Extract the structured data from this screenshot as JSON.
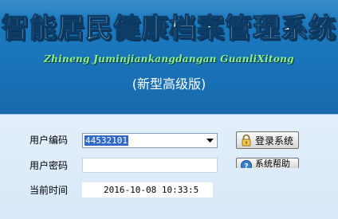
{
  "header": {
    "title": "智能居民健康档案管理系统",
    "subtitle_en": "Zhineng Juminjiankangdangan GuanliXitong",
    "edition": "(新型高级版)"
  },
  "form": {
    "user_label": "用户编码",
    "user_value": "44532101",
    "password_label": "用户密码",
    "password_value": "",
    "time_label": "当前时间",
    "time_value": "2016-10-08 10:33:5"
  },
  "buttons": {
    "login_label": "登录系统",
    "help_label": "系统帮助"
  },
  "icons": {
    "login": "lock-icon",
    "help": "help-icon",
    "dropdown": "chevron-down-icon"
  },
  "colors": {
    "banner": "#1a73b8",
    "panel": "#dde9f7",
    "selection": "#316ac5",
    "subtitle": "#8ff08f"
  }
}
